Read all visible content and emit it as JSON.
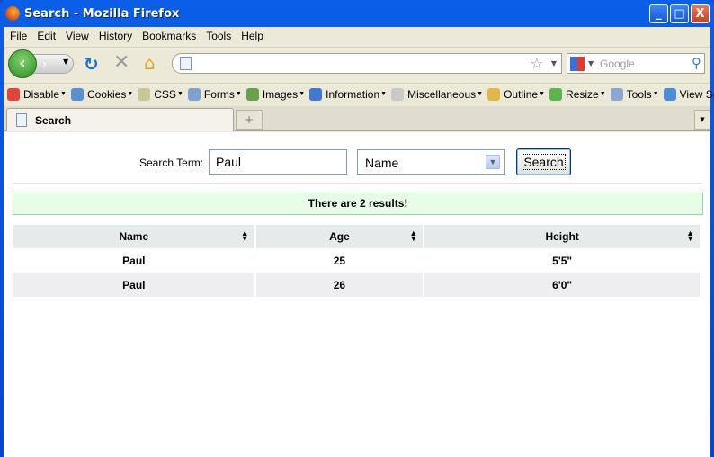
{
  "window": {
    "title": "Search - Mozilla Firefox",
    "controls": {
      "minimize": "_",
      "maximize": "□",
      "close": "X"
    }
  },
  "menu": [
    "File",
    "Edit",
    "View",
    "History",
    "Bookmarks",
    "Tools",
    "Help"
  ],
  "nav": {
    "url": "",
    "search_placeholder": "Google"
  },
  "addons": [
    {
      "label": "Disable",
      "color": "#e0443a"
    },
    {
      "label": "Cookies",
      "color": "#5d8fd0"
    },
    {
      "label": "CSS",
      "color": "#c8c79a"
    },
    {
      "label": "Forms",
      "color": "#7ea2cf"
    },
    {
      "label": "Images",
      "color": "#6a9f4b"
    },
    {
      "label": "Information",
      "color": "#3f7ad0"
    },
    {
      "label": "Miscellaneous",
      "color": "#c9c9c9"
    },
    {
      "label": "Outline",
      "color": "#e0b84a"
    },
    {
      "label": "Resize",
      "color": "#5bb44c"
    },
    {
      "label": "Tools",
      "color": "#8aa7d6"
    },
    {
      "label": "View Source",
      "color": "#4a8ed8"
    }
  ],
  "tabs": [
    {
      "label": "Search"
    }
  ],
  "new_tab": "+",
  "form": {
    "label": "Search Term:",
    "term": "Paul",
    "field": "Name",
    "button": "Search"
  },
  "banner": "There are 2 results!",
  "table": {
    "headers": [
      "Name",
      "Age",
      "Height"
    ],
    "rows": [
      [
        "Paul",
        "25",
        "5'5\""
      ],
      [
        "Paul",
        "26",
        "6'0\""
      ]
    ]
  }
}
